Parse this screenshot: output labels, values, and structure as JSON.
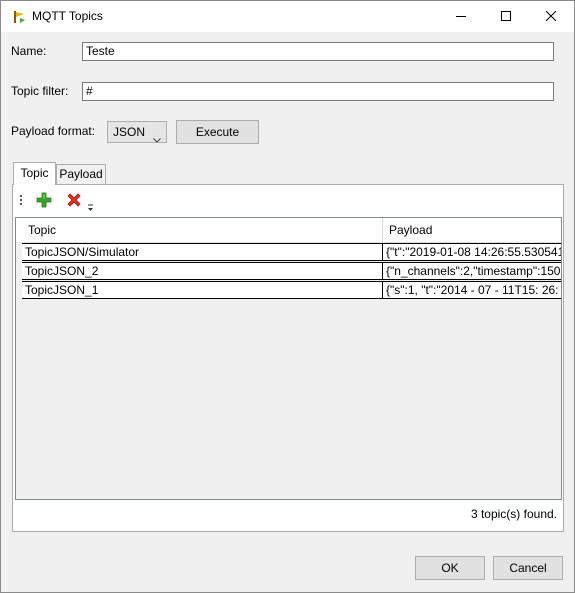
{
  "window": {
    "title": "MQTT Topics"
  },
  "form": {
    "name_label": "Name:",
    "name_value": "Teste",
    "topic_filter_label": "Topic filter:",
    "topic_filter_value": "#",
    "payload_format_label": "Payload format:",
    "payload_format_value": "JSON",
    "execute_label": "Execute"
  },
  "tabs": [
    {
      "label": "Topic",
      "active": true
    },
    {
      "label": "Payload",
      "active": false
    }
  ],
  "grid": {
    "columns": [
      "Topic",
      "Payload"
    ],
    "rows": [
      {
        "topic": "TopicJSON/Simulator",
        "payload": "{\"t\":\"2019-01-08 14:26:55.530541"
      },
      {
        "topic": "TopicJSON_2",
        "payload": "{\"n_channels\":2,\"timestamp\":150"
      },
      {
        "topic": "TopicJSON_1",
        "payload": "{\"s\":1, \"t\":\"2014 - 07 - 11T15: 26:"
      }
    ]
  },
  "status_text": "3 topic(s) found.",
  "footer": {
    "ok_label": "OK",
    "cancel_label": "Cancel"
  },
  "icons": {
    "app": "mqtt-app-icon",
    "add": "add-icon",
    "delete": "delete-icon"
  },
  "colors": {
    "add_green": "#3aa52b",
    "delete_red": "#e0321c"
  }
}
